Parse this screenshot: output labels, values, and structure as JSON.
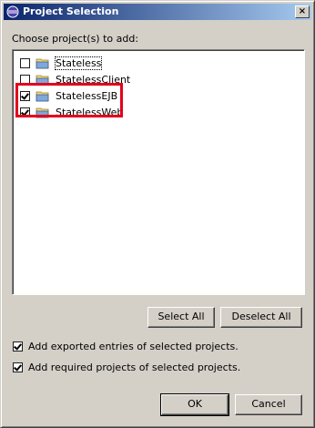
{
  "window": {
    "title": "Project Selection",
    "close_glyph": "×"
  },
  "list": {
    "label": "Choose project(s) to add:",
    "items": [
      {
        "label": "Stateless",
        "checked": false,
        "icon": "folder-icon"
      },
      {
        "label": "StatelessClient",
        "checked": false,
        "icon": "folder-icon"
      },
      {
        "label": "StatelessEJB",
        "checked": true,
        "icon": "folder-icon"
      },
      {
        "label": "StatelessWeb",
        "checked": true,
        "icon": "folder-icon"
      }
    ]
  },
  "buttons": {
    "select_all": "Select All",
    "deselect_all": "Deselect All",
    "ok": "OK",
    "cancel": "Cancel"
  },
  "options": [
    {
      "label": "Add exported entries of selected projects.",
      "checked": true
    },
    {
      "label": "Add required projects of selected projects.",
      "checked": true
    }
  ],
  "colors": {
    "highlight_box": "#e3001b",
    "titlebar_start": "#0a246a",
    "titlebar_end": "#a6caf0"
  }
}
